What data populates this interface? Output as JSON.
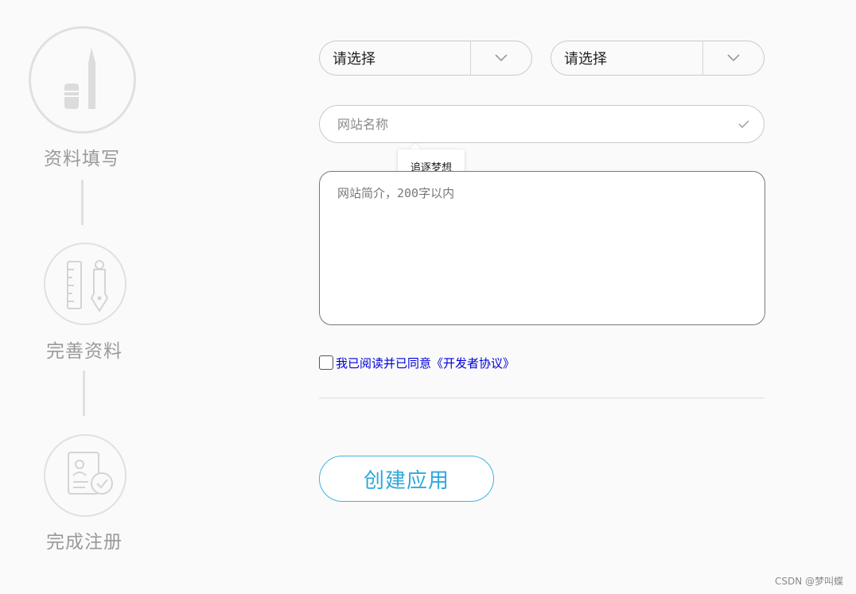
{
  "steps": [
    {
      "label": "资料填写",
      "icon": "pen-icon"
    },
    {
      "label": "完善资料",
      "icon": "ruler-pen-icon"
    },
    {
      "label": "完成注册",
      "icon": "document-check-icon"
    }
  ],
  "form": {
    "select1": {
      "value": "请选择",
      "icon": "chevron-down-icon"
    },
    "select2": {
      "value": "请选择",
      "icon": "chevron-down-icon"
    },
    "site_name": {
      "placeholder": "网站名称",
      "value": "",
      "icon": "check-icon"
    },
    "tooltip": "追逐梦想",
    "intro": {
      "placeholder": "网站简介，200字以内",
      "value": ""
    },
    "agreement": {
      "label": "我已阅读并已同意《开发者协议》",
      "checked": false
    },
    "submit_label": "创建应用"
  },
  "watermark": "CSDN @梦叫蝶",
  "colors": {
    "accent": "#2ea9dc",
    "link": "#0000d8",
    "step_gray": "#9a9a9a",
    "border": "#c9c9c9"
  }
}
